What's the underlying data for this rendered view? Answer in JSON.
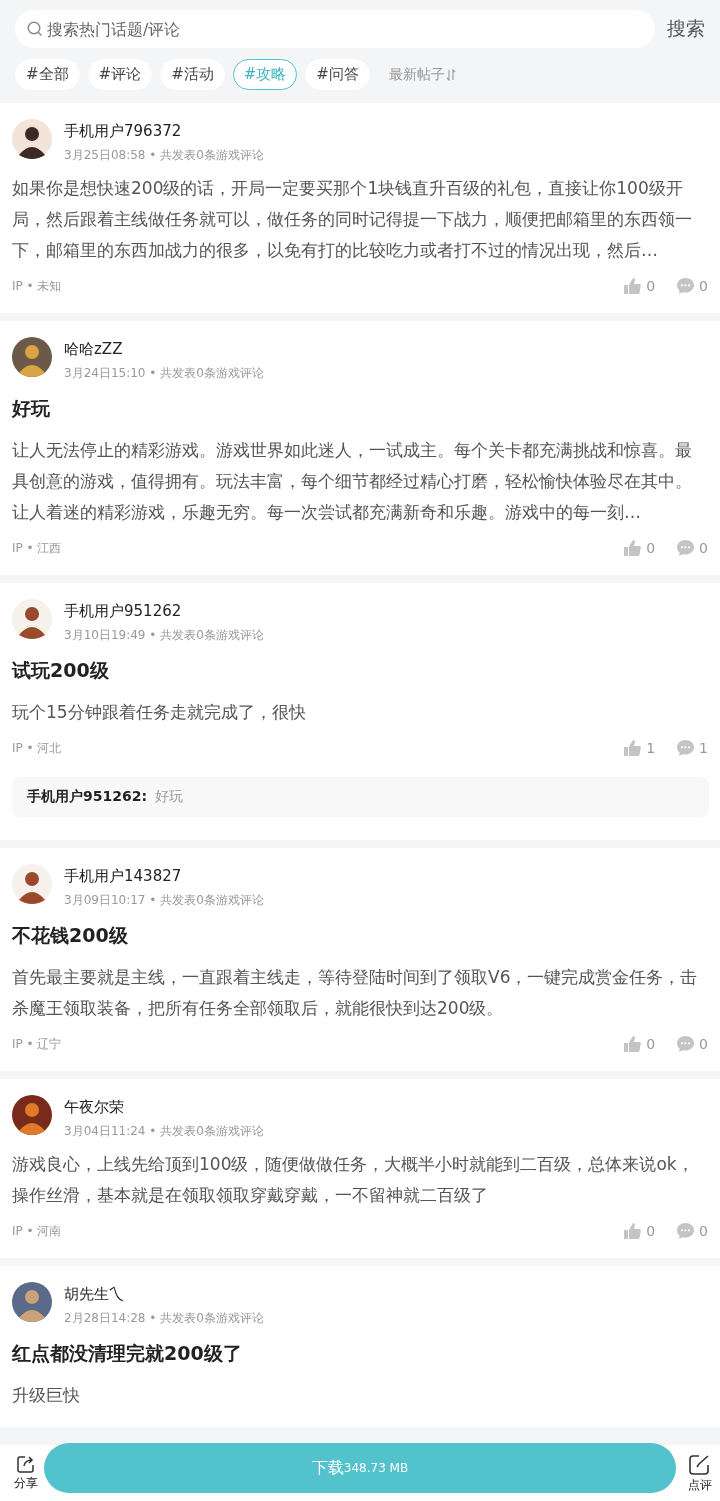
{
  "search": {
    "placeholder": "搜索热门话题/评论",
    "button": "搜索"
  },
  "tags": [
    {
      "label": "#全部",
      "selected": false
    },
    {
      "label": "#评论",
      "selected": false
    },
    {
      "label": "#活动",
      "selected": false
    },
    {
      "label": "#攻略",
      "selected": true
    },
    {
      "label": "#问答",
      "selected": false
    }
  ],
  "sort": {
    "label": "最新帖子"
  },
  "posts": [
    {
      "user": "手机用户796372",
      "meta": "3月25日08:58 • 共发表0条游戏评论",
      "body": "如果你是想快速200级的话，开局一定要买那个1块钱直升百级的礼包，直接让你100级开局，然后跟着主线做任务就可以，做任务的同时记得提一下战力，顺便把邮箱里的东西领一下，邮箱里的东西加战力的很多，以免有打的比较吃力或者打不过的情况出现，然后…",
      "ip": "IP • 未知",
      "likes": "0",
      "comments": "0"
    },
    {
      "user": "哈哈zZZ",
      "meta": "3月24日15:10 • 共发表0条游戏评论",
      "title": "好玩",
      "body": "让人无法停止的精彩游戏。游戏世界如此迷人，一试成主。每个关卡都充满挑战和惊喜。最具创意的游戏，值得拥有。玩法丰富，每个细节都经过精心打磨，轻松愉快体验尽在其中。让人着迷的精彩游戏，乐趣无穷。每一次尝试都充满新奇和乐趣。游戏中的每一刻…",
      "ip": "IP • 江西",
      "likes": "0",
      "comments": "0"
    },
    {
      "user": "手机用户951262",
      "meta": "3月10日19:49 • 共发表0条游戏评论",
      "title": "试玩200级",
      "body": "玩个15分钟跟着任务走就完成了，很快",
      "ip": "IP • 河北",
      "likes": "1",
      "comments": "1",
      "reply": {
        "user": "手机用户951262:",
        "text": "好玩"
      }
    },
    {
      "user": "手机用户143827",
      "meta": "3月09日10:17 • 共发表0条游戏评论",
      "title": "不花钱200级",
      "body": "首先最主要就是主线，一直跟着主线走，等待登陆时间到了领取V6，一键完成赏金任务，击杀魔王领取装备，把所有任务全部领取后，就能很快到达200级。",
      "ip": "IP • 辽宁",
      "likes": "0",
      "comments": "0"
    },
    {
      "user": "午夜尔荣",
      "meta": "3月04日11:24 • 共发表0条游戏评论",
      "body": "游戏良心，上线先给顶到100级，随便做做任务，大概半小时就能到二百级，总体来说ok，操作丝滑，基本就是在领取领取穿戴穿戴，一不留神就二百级了",
      "ip": "IP • 河南",
      "likes": "0",
      "comments": "0"
    },
    {
      "user": "胡先生乀",
      "meta": "2月28日14:28 • 共发表0条游戏评论",
      "title": "红点都没清理完就200级了",
      "body": "升级巨快"
    }
  ],
  "bottom_bar": {
    "share": "分享",
    "download": "下载",
    "size": "348.73 MB",
    "review": "点评"
  }
}
